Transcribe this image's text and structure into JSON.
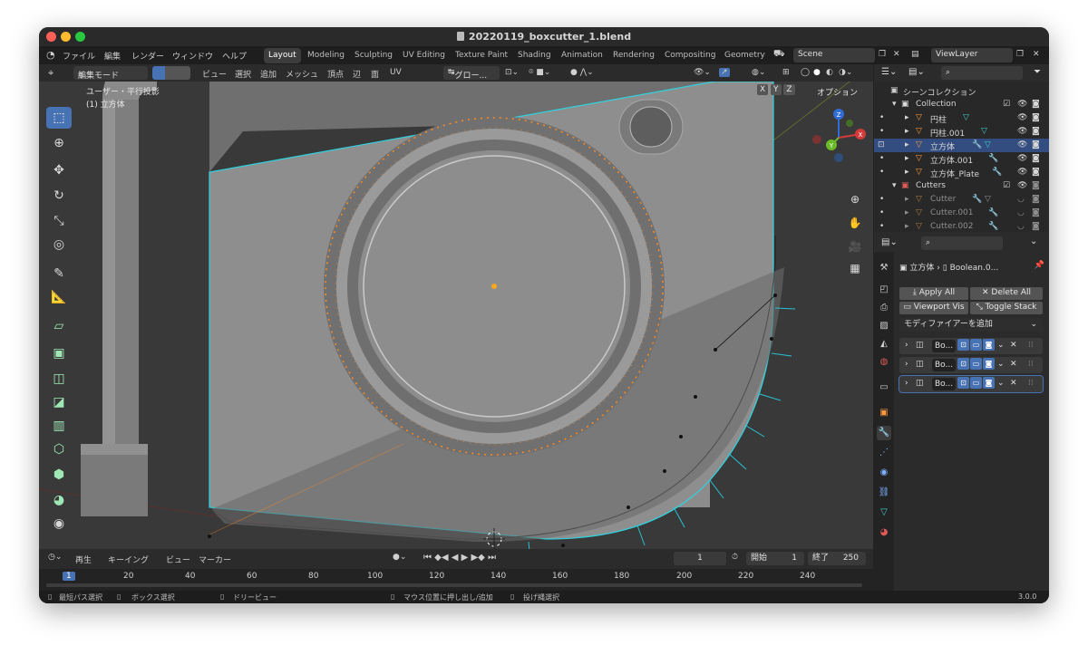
{
  "window": {
    "title": "20220119_boxcutter_1.blend"
  },
  "menubar": {
    "menus": [
      "ファイル",
      "編集",
      "レンダー",
      "ウィンドウ",
      "ヘルプ"
    ],
    "workspaces": [
      "Layout",
      "Modeling",
      "Sculpting",
      "UV Editing",
      "Texture Paint",
      "Shading",
      "Animation",
      "Rendering",
      "Compositing",
      "Geometry"
    ],
    "active_workspace": "Layout",
    "scene": "Scene",
    "view_layer": "ViewLayer"
  },
  "viewport_header": {
    "mode": "編集モード",
    "menus": [
      "ビュー",
      "選択",
      "追加",
      "メッシュ",
      "頂点",
      "辺",
      "面",
      "UV"
    ],
    "transform_orientation": "グロー...",
    "axes": [
      "X",
      "Y",
      "Z"
    ],
    "options": "オプション"
  },
  "viewport": {
    "view_name": "ユーザー・平行投影",
    "object_info": "(1) 立方体",
    "gizmo_axes": [
      "X",
      "Y",
      "Z"
    ]
  },
  "timeline": {
    "menus": [
      "再生",
      "キーイング",
      "ビュー",
      "マーカー"
    ],
    "current_frame": "1",
    "start_label": "開始",
    "start": "1",
    "end_label": "終了",
    "end": "250",
    "ruler": [
      "1",
      "20",
      "40",
      "60",
      "80",
      "100",
      "120",
      "140",
      "160",
      "180",
      "200",
      "220",
      "240"
    ]
  },
  "statusbar": {
    "items": [
      "最短パス選択",
      "ボックス選択",
      "ドリービュー",
      "マウス位置に押し出し/追加",
      "投げ縄選択"
    ],
    "version": "3.0.0"
  },
  "outliner": {
    "scene_collection": "シーンコレクション",
    "collection": "Collection",
    "objects": [
      "円柱",
      "円柱.001",
      "立方体",
      "立方体.001",
      "立方体_Plate"
    ],
    "cutters_collection": "Cutters",
    "cutters": [
      "Cutter",
      "Cutter.001",
      "Cutter.002"
    ]
  },
  "properties": {
    "breadcrumb_object": "立方体",
    "breadcrumb_modifier": "Boolean.0...",
    "apply_all": "Apply All",
    "delete_all": "Delete All",
    "viewport_vis": "Viewport Vis",
    "toggle_stack": "Toggle Stack",
    "add_modifier": "モディファイアーを追加",
    "modifiers": [
      "Bo...",
      "Bo...",
      "Bo..."
    ]
  },
  "colors": {
    "accent": "#4772b3",
    "selection_orange": "#ff8a1c",
    "wire_cyan": "#27c3d4",
    "viewport_bg": "#393939"
  }
}
